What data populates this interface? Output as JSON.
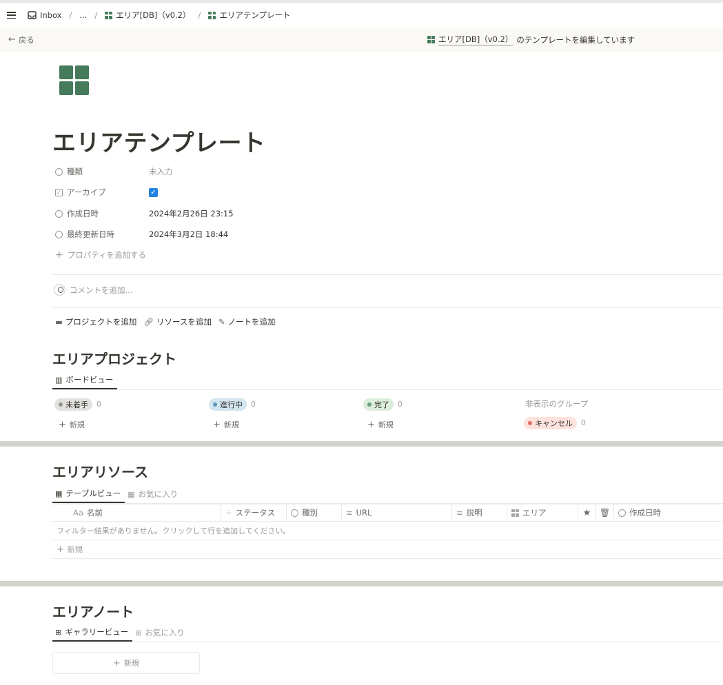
{
  "topbar": {
    "inbox": "Inbox",
    "ellipsis": "...",
    "db_crumb": "エリア[DB]（v0.2）",
    "page_crumb": "エリアテンプレート",
    "sep": "/"
  },
  "banner": {
    "back": "戻る",
    "db_name": "エリア[DB]（v0.2）",
    "message": "のテンプレートを編集しています"
  },
  "page": {
    "title": "エリアテンプレート",
    "properties": [
      {
        "name": "種類",
        "value": "未入力",
        "icon": "select-icon"
      },
      {
        "name": "アーカイブ",
        "value": "✓",
        "icon": "checkbox-icon"
      },
      {
        "name": "作成日時",
        "value": "2024年2月26日 23:15",
        "icon": "clock-icon"
      },
      {
        "name": "最終更新日時",
        "value": "2024年3月2日 18:44",
        "icon": "clock-icon"
      }
    ],
    "add_property": "プロパティを追加する",
    "comment_placeholder": "コメントを追加...",
    "actions": [
      "プロジェクトを追加",
      "リソースを追加",
      "ノートを追加"
    ]
  },
  "projects": {
    "title": "エリアプロジェクト",
    "tab": "ボードビュー",
    "columns": [
      {
        "label": "未着手",
        "count": "0",
        "color": "#e3e2e0",
        "dot": "#91918e",
        "new": "新規"
      },
      {
        "label": "進行中",
        "count": "0",
        "color": "#d3e5ef",
        "dot": "#5b97bd",
        "new": "新規"
      },
      {
        "label": "完了",
        "count": "0",
        "color": "#dbeddb",
        "dot": "#6c9b7d",
        "new": "新規"
      }
    ],
    "hidden_groups": "非表示のグループ",
    "hidden": {
      "label": "キャンセル",
      "count": "0",
      "color": "#ffe2dd",
      "dot": "#e16f64"
    }
  },
  "resources": {
    "title": "エリアリソース",
    "tabs": [
      "テーブルビュー",
      "お気に入り"
    ],
    "columns": [
      "名前",
      "ステータス",
      "種別",
      "URL",
      "説明",
      "エリア",
      "",
      "",
      "作成日時"
    ],
    "name_prefix": "Aa",
    "empty": "フィルター結果がありません。クリックして行を追加してください。",
    "new": "新規"
  },
  "notes": {
    "title": "エリアノート",
    "tabs": [
      "ギャラリービュー",
      "お気に入り"
    ],
    "new": "新規"
  }
}
